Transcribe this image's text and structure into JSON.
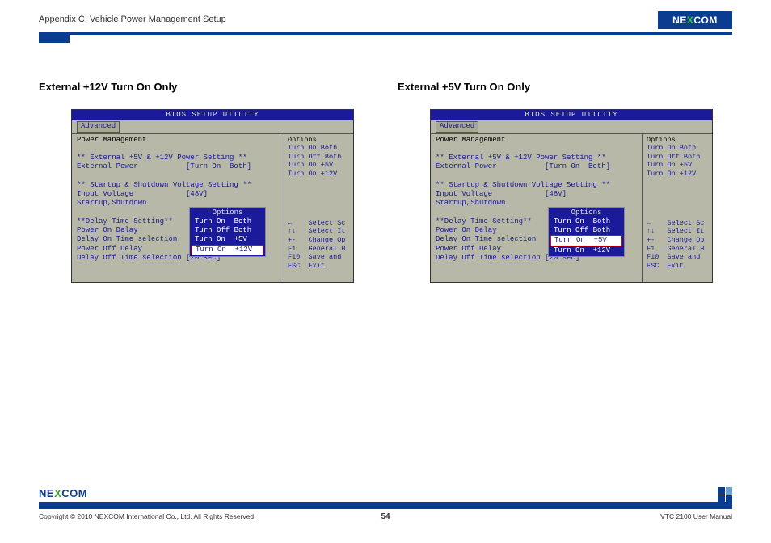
{
  "header": {
    "breadcrumb": "Appendix C: Vehicle Power Management Setup",
    "logo_parts": [
      "NE",
      "X",
      "COM"
    ]
  },
  "columns": [
    {
      "title": "External +12V Turn On Only",
      "bios": {
        "titlebar": "BIOS SETUP UTILITY",
        "tab": "Advanced",
        "main": {
          "heading": "Power Management",
          "sections": [
            "** External +5V & +12V Power Setting **",
            "External Power           [Turn On  Both]",
            "",
            "** Startup & Shutdown Voltage Setting **",
            "Input Voltage            [48V]",
            "Startup,Shutdown",
            "",
            "**Delay Time Setting**",
            "Power On Delay",
            "Delay On Time selection",
            "Power Off Delay",
            "Delay Off Time selection [20 sec]"
          ]
        },
        "side": {
          "heading": "Options",
          "options": [
            "Turn On  Both",
            "Turn Off Both",
            "Turn On  +5V",
            "Turn On  +12V"
          ],
          "legend": [
            "←    Select Sc",
            "↑↓   Select It",
            "+-   Change Op",
            "F1   General H",
            "F10  Save and",
            "ESC  Exit"
          ]
        },
        "popup": {
          "title": "Options",
          "items": [
            "Turn On  Both",
            "Turn Off Both",
            "Turn On  +5V",
            "Turn On  +12V"
          ],
          "selected_index": 3
        }
      }
    },
    {
      "title": "External +5V Turn On Only",
      "bios": {
        "titlebar": "BIOS SETUP UTILITY",
        "tab": "Advanced",
        "main": {
          "heading": "Power Management",
          "sections": [
            "** External +5V & +12V Power Setting **",
            "External Power           [Turn On  Both]",
            "",
            "** Startup & Shutdown Voltage Setting **",
            "Input Voltage            [48V]",
            "Startup,Shutdown",
            "",
            "**Delay Time Setting**",
            "Power On Delay",
            "Delay On Time selection",
            "Power Off Delay",
            "Delay Off Time selection [20 sec]"
          ]
        },
        "side": {
          "heading": "Options",
          "options": [
            "Turn On  Both",
            "Turn Off Both",
            "Turn On  +5V",
            "Turn On  +12V"
          ],
          "legend": [
            "←    Select Sc",
            "↑↓   Select It",
            "+-   Change Op",
            "F1   General H",
            "F10  Save and",
            "ESC  Exit"
          ]
        },
        "popup": {
          "title": "Options",
          "items": [
            "Turn On  Both",
            "Turn Off Both",
            "Turn On  +5V",
            "Turn On  +12V"
          ],
          "selected_index": 2
        }
      }
    }
  ],
  "footer": {
    "logo_parts": [
      "NE",
      "X",
      "COM"
    ],
    "copyright": "Copyright © 2010 NEXCOM International Co., Ltd. All Rights Reserved.",
    "page": "54",
    "manual": "VTC 2100 User Manual"
  }
}
